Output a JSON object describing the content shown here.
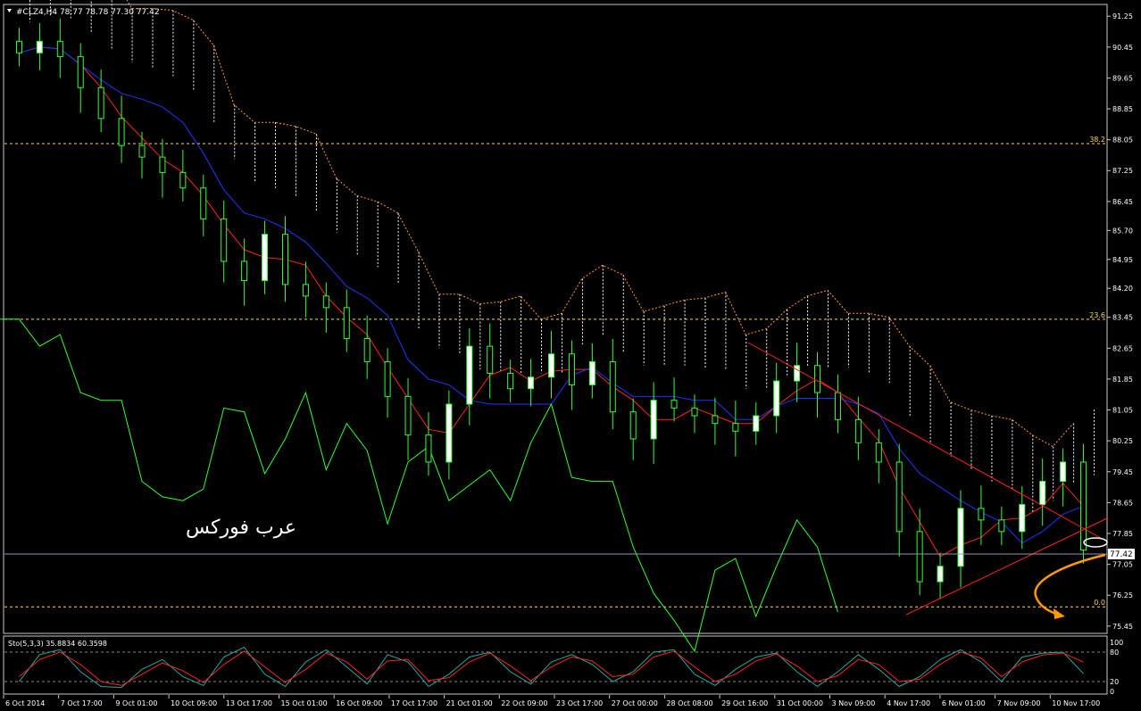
{
  "header": {
    "symbol_info": "#CLZ4,H4  78.77 78.78 77.30 77.42",
    "oscillator_info": "Sto(5,3,3) 35.8834 60.3598"
  },
  "watermark": "عرب فوركس",
  "current_price_label": "77.42",
  "colors": {
    "background": "#000000",
    "bull_candle": "#ffffff",
    "candle_wick": "#33ff33",
    "tenkan": "#ff2222",
    "kijun": "#2233ff",
    "chikou": "#33ff33",
    "cloud": "#ffffff",
    "cloud_edge": "#ff9933",
    "trendline": "#ff2222",
    "fib": "#ffd94a",
    "arrow": "#ff9900",
    "stoch_main": "#22aaaa",
    "stoch_signal": "#ff2222"
  },
  "chart_data": [
    {
      "type": "candlestick",
      "title": "#CLZ4,H4",
      "ylim": [
        75.4,
        91.3
      ],
      "y_ticks": [
        "91.25",
        "90.45",
        "89.65",
        "88.85",
        "88.05",
        "87.25",
        "86.45",
        "85.70",
        "84.95",
        "84.20",
        "83.45",
        "82.65",
        "81.85",
        "81.05",
        "80.25",
        "79.45",
        "78.65",
        "77.85",
        "77.05",
        "76.25",
        "75.45"
      ],
      "x_labels": [
        "6 Oct 2014",
        "7 Oct 17:00",
        "9 Oct 01:00",
        "10 Oct 09:00",
        "13 Oct 17:00",
        "15 Oct 01:00",
        "16 Oct 09:00",
        "17 Oct 17:00",
        "21 Oct 01:00",
        "22 Oct 09:00",
        "23 Oct 17:00",
        "27 Oct 00:00",
        "28 Oct 08:00",
        "29 Oct 16:00",
        "31 Oct 00:00",
        "3 Nov 09:00",
        "4 Nov 17:00",
        "6 Nov 01:00",
        "7 Nov 09:00",
        "10 Nov 17:00"
      ],
      "fib_levels": [
        {
          "label": "38.2",
          "value": 87.95
        },
        {
          "label": "23.6",
          "value": 83.4
        },
        {
          "label": "0.0",
          "value": 75.95
        }
      ],
      "last_price": 77.42,
      "close_estimates": [
        90.3,
        90.6,
        90.2,
        89.4,
        88.6,
        87.9,
        87.6,
        87.2,
        86.8,
        86.0,
        84.9,
        84.4,
        85.6,
        84.3,
        84.0,
        83.7,
        82.9,
        82.3,
        81.4,
        80.4,
        79.7,
        81.2,
        82.7,
        82.0,
        81.6,
        81.9,
        82.5,
        81.7,
        82.3,
        81.0,
        80.3,
        81.3,
        81.1,
        80.9,
        80.7,
        80.5,
        80.9,
        81.8,
        82.2,
        81.5,
        80.8,
        80.2,
        79.7,
        77.9,
        76.6,
        77.0,
        78.5,
        78.2,
        77.9,
        78.6,
        79.2,
        79.7,
        77.42
      ],
      "lines": {
        "tenkan": "red",
        "kijun": "blue",
        "chikou": "green",
        "kumo": "dotted cloud"
      }
    },
    {
      "type": "line",
      "title": "Sto(5,3,3)",
      "ylim": [
        0,
        100
      ],
      "y_ticks": [
        "100",
        "80",
        "20",
        "0"
      ],
      "series": [
        {
          "name": "",
          "values": [
            20,
            75,
            85,
            40,
            10,
            8,
            45,
            65,
            30,
            12,
            70,
            90,
            35,
            10,
            60,
            85,
            50,
            15,
            75,
            60,
            10,
            35,
            70,
            80,
            40,
            15,
            60,
            75,
            55,
            20,
            40,
            80,
            85,
            35,
            12,
            45,
            70,
            78,
            40,
            10,
            40,
            75,
            45,
            10,
            30,
            65,
            85,
            60,
            20,
            70,
            78,
            80,
            36
          ]
        },
        {
          "name": "",
          "values": [
            30,
            65,
            80,
            55,
            20,
            12,
            35,
            58,
            42,
            18,
            55,
            82,
            50,
            18,
            45,
            78,
            60,
            25,
            62,
            65,
            22,
            28,
            60,
            78,
            52,
            22,
            50,
            70,
            62,
            30,
            35,
            70,
            82,
            50,
            20,
            35,
            62,
            76,
            52,
            20,
            32,
            65,
            55,
            20,
            25,
            55,
            80,
            68,
            30,
            60,
            74,
            78,
            60
          ]
        }
      ]
    }
  ]
}
